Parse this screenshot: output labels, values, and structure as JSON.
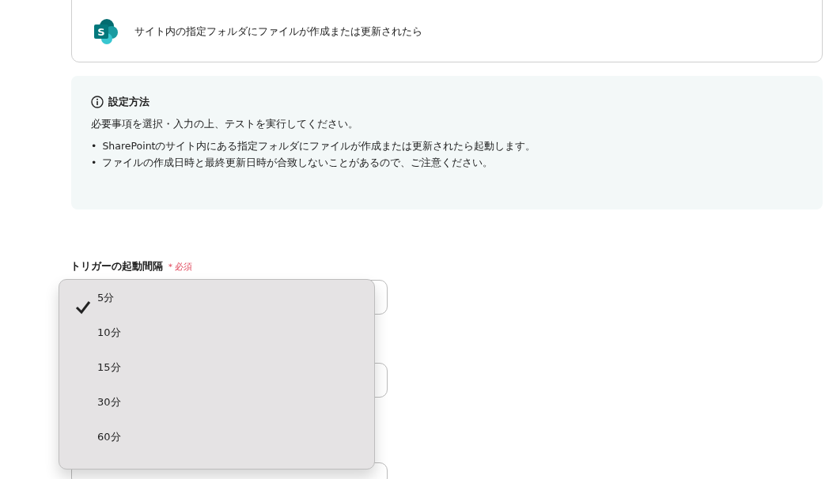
{
  "trigger_card": {
    "title": "サイト内の指定フォルダにファイルが作成または更新されたら"
  },
  "trigger_logo": {
    "letter": "S"
  },
  "info": {
    "bullet": "•",
    "heading": "設定方法",
    "intro": "必要事項を選択・入力の上、テストを実行してください。",
    "bullets": [
      "SharePointのサイト内にある指定フォルダにファイルが作成または更新されたら起動します。",
      "ファイルの作成日時と最終更新日時が合致しないことがあるので、ご注意ください。"
    ]
  },
  "interval_field": {
    "label": "トリガーの起動間隔",
    "required": "＊必須"
  },
  "dropdown": {
    "options": [
      {
        "label": "5分",
        "selected": true
      },
      {
        "label": "10分",
        "selected": false
      },
      {
        "label": "15分",
        "selected": false
      },
      {
        "label": "30分",
        "selected": false
      },
      {
        "label": "60分",
        "selected": false
      }
    ]
  }
}
